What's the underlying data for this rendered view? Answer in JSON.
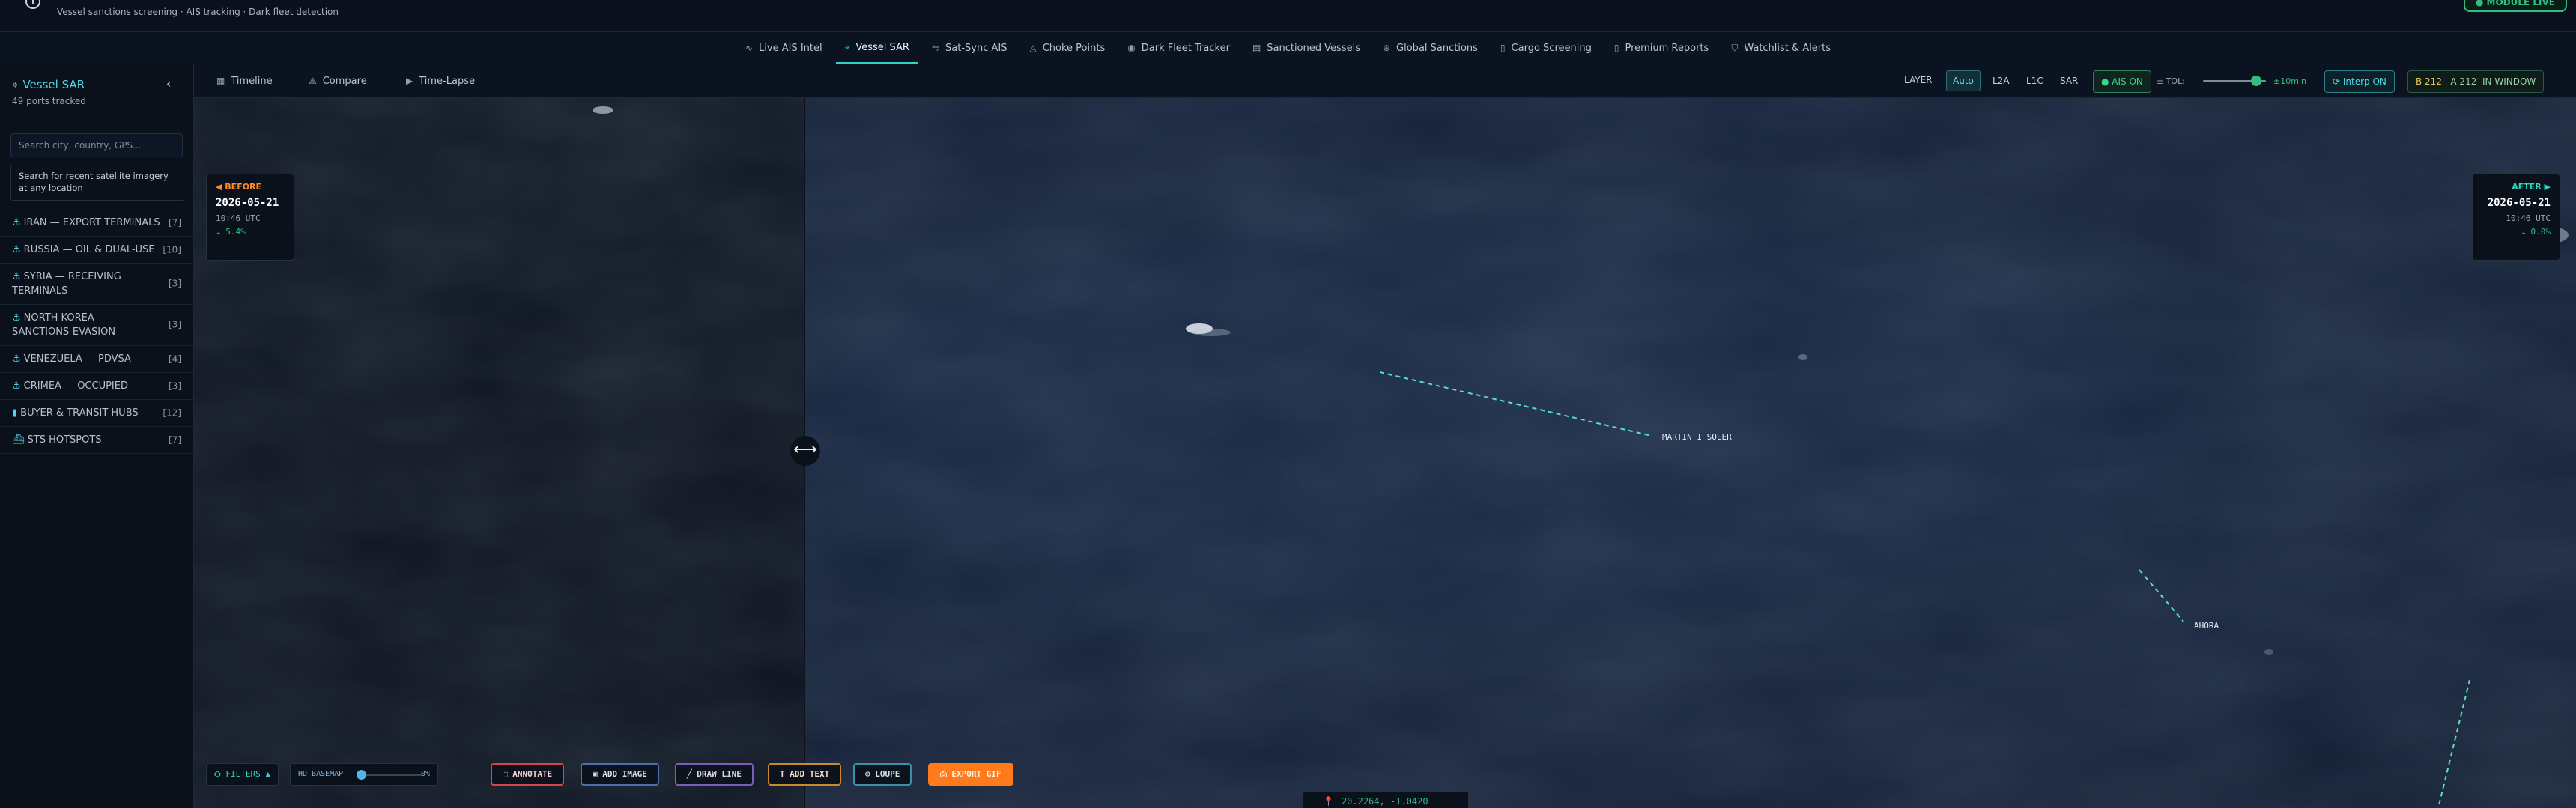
{
  "header": {
    "subtitle": "Vessel sanctions screening · AIS tracking · Dark fleet detection",
    "live_badge": "● MODULE LIVE",
    "info_icon": "info-icon"
  },
  "nav": {
    "tabs": [
      {
        "label": "Live AIS Intel",
        "icon": "pulse-icon",
        "glyph": "∿"
      },
      {
        "label": "Vessel SAR",
        "icon": "satellite-icon",
        "glyph": "⌖",
        "active": true
      },
      {
        "label": "Sat-Sync AIS",
        "icon": "sync-icon",
        "glyph": "⇋"
      },
      {
        "label": "Choke Points",
        "icon": "flame-icon",
        "glyph": "◬"
      },
      {
        "label": "Dark Fleet Tracker",
        "icon": "radar-icon",
        "glyph": "◉"
      },
      {
        "label": "Sanctioned Vessels",
        "icon": "list-icon",
        "glyph": "▤"
      },
      {
        "label": "Global Sanctions",
        "icon": "globe-icon",
        "glyph": "⊕"
      },
      {
        "label": "Cargo Screening",
        "icon": "document-icon",
        "glyph": "▯"
      },
      {
        "label": "Premium Reports",
        "icon": "report-icon",
        "glyph": "▯"
      },
      {
        "label": "Watchlist & Alerts",
        "icon": "shield-icon",
        "glyph": "⛉"
      }
    ]
  },
  "sidebar": {
    "title": "Vessel SAR",
    "ports_tracked": "49 ports tracked",
    "search_placeholder": "Search city, country, GPS...",
    "hint": "Search for recent satellite imagery at any location",
    "regions": [
      {
        "label": "IRAN — EXPORT TERMINALS",
        "count": "[7]",
        "icon": "anchor-icon",
        "glyph": "⚓"
      },
      {
        "label": "RUSSIA — OIL & DUAL-USE",
        "count": "[10]",
        "icon": "anchor-icon",
        "glyph": "⚓"
      },
      {
        "label": "SYRIA — RECEIVING TERMINALS",
        "count": "[3]",
        "icon": "anchor-icon",
        "glyph": "⚓"
      },
      {
        "label": "NORTH KOREA — SANCTIONS-EVASION",
        "count": "[3]",
        "icon": "anchor-icon",
        "glyph": "⚓"
      },
      {
        "label": "VENEZUELA — PDVSA",
        "count": "[4]",
        "icon": "anchor-icon",
        "glyph": "⚓"
      },
      {
        "label": "CRIMEA — OCCUPIED",
        "count": "[3]",
        "icon": "anchor-icon",
        "glyph": "⚓"
      },
      {
        "label": "BUYER & TRANSIT HUBS",
        "count": "[12]",
        "icon": "building-icon",
        "glyph": "▮"
      },
      {
        "label": "STS HOTSPOTS",
        "count": "[7]",
        "icon": "ship-icon",
        "glyph": "⛴"
      }
    ]
  },
  "toolbar": {
    "view_tabs": [
      {
        "label": "Timeline",
        "icon": "calendar-icon",
        "glyph": "▦"
      },
      {
        "label": "Compare",
        "icon": "compare-icon",
        "glyph": "⟁"
      },
      {
        "label": "Time-Lapse",
        "icon": "film-icon",
        "glyph": "▶"
      }
    ],
    "layer_label": "LAYER",
    "layers": [
      "Auto",
      "L2A",
      "L1C",
      "SAR"
    ],
    "active_layer": "Auto",
    "ais_toggle": "● AIS ON",
    "tolerance_label": "± TOL:",
    "tolerance_value": "±10min",
    "tolerance_level": 0.85,
    "interp_toggle": "⟳ Interp ON",
    "counts": {
      "b": "B 212",
      "a": "A 212",
      "status": "IN-WINDOW"
    }
  },
  "compare": {
    "before": {
      "label": "◀ BEFORE",
      "date": "2026-05-21",
      "time": "10:46 UTC",
      "cloud": "☁ 5.4%"
    },
    "after": {
      "label": "AFTER ▶",
      "date": "2026-05-21",
      "time": "10:46 UTC",
      "cloud": "☁ 0.0%"
    },
    "split_icon": "⟷"
  },
  "vessels": [
    {
      "name": "MARTIN I SOLER"
    },
    {
      "name": "AHORA"
    }
  ],
  "bottom_tools": {
    "filters": "⛭ FILTERS ▲",
    "basemap_label": "HD BASEMAP",
    "basemap_pct": "0%",
    "basemap_level": 0,
    "annotate": "⬚ ANNOTATE",
    "add_image": "▣ ADD IMAGE",
    "draw_line": "╱ DRAW LINE",
    "add_text": "T ADD TEXT",
    "loupe": "⊙ LOUPE",
    "export_gif": "⎙ EXPORT GIF"
  },
  "coords": {
    "pin": "📍",
    "text": "20.2264, -1.0420"
  },
  "colors": {
    "accent": "#2ed3c1",
    "ais_green": "#2fbf7f",
    "before_orange": "#ff8a2b",
    "export_orange": "#ff7a1a"
  }
}
